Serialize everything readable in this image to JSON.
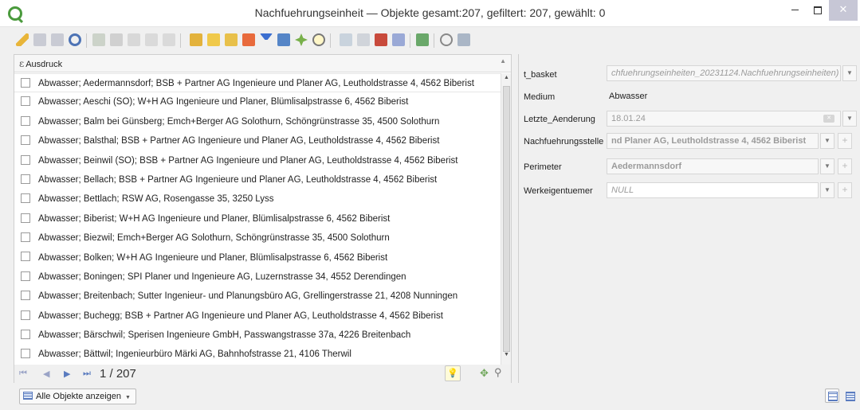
{
  "window": {
    "title": "Nachfuehrungseinheit — Objekte gesamt:207, gefiltert: 207, gewählt: 0"
  },
  "toolbar": {
    "icons": [
      "pencil-icon",
      "save-icon",
      "save-all-icon",
      "reload-icon",
      "add-feature-icon",
      "delete-icon",
      "cut-icon",
      "copy-icon",
      "paste-icon",
      "expression-select-icon",
      "select-all-icon",
      "invert-selection-icon",
      "deselect-icon",
      "filter-icon",
      "move-selection-top-icon",
      "pan-icon",
      "zoom-icon",
      "new-field-icon",
      "delete-field-icon",
      "field-calculator-icon",
      "conditional-format-icon",
      "actions-icon",
      "dock-icon",
      "dock-toggle-icon"
    ]
  },
  "list": {
    "header": "Ausdruck",
    "rows": [
      "Abwasser; Aedermannsdorf; BSB + Partner AG Ingenieure und Planer AG, Leutholdstrasse 4, 4562 Biberist",
      "Abwasser; Aeschi (SO); W+H AG Ingenieure und Planer, Blümlisalpstrasse 6, 4562 Biberist",
      "Abwasser; Balm bei Günsberg; Emch+Berger AG Solothurn, Schöngrünstrasse 35, 4500 Solothurn",
      "Abwasser; Balsthal; BSB + Partner AG Ingenieure und Planer AG, Leutholdstrasse 4, 4562 Biberist",
      "Abwasser; Beinwil (SO); BSB + Partner AG Ingenieure und Planer AG, Leutholdstrasse 4, 4562 Biberist",
      "Abwasser; Bellach; BSB + Partner AG Ingenieure und Planer AG, Leutholdstrasse 4, 4562 Biberist",
      "Abwasser; Bettlach; RSW AG, Rosengasse 35, 3250 Lyss",
      "Abwasser; Biberist; W+H AG Ingenieure und Planer, Blümlisalpstrasse 6, 4562 Biberist",
      "Abwasser; Biezwil; Emch+Berger AG Solothurn, Schöngrünstrasse 35, 4500 Solothurn",
      "Abwasser; Bolken; W+H AG Ingenieure und Planer, Blümlisalpstrasse 6, 4562 Biberist",
      "Abwasser; Boningen; SPI Planer und Ingenieure AG, Luzernstrasse 34, 4552 Derendingen",
      "Abwasser; Breitenbach; Sutter Ingenieur- und Planungsbüro AG, Grellingerstrasse 21, 4208 Nunningen",
      "Abwasser; Buchegg; BSB + Partner AG Ingenieure und Planer AG, Leutholdstrasse 4, 4562 Biberist",
      "Abwasser; Bärschwil; Sperisen Ingenieure GmbH, Passwangstrasse 37a, 4226 Breitenbach",
      "Abwasser; Bättwil; Ingenieurbüro Märki AG, Bahnhofstrasse 21, 4106 Therwil"
    ]
  },
  "nav": {
    "counter": "1 / 207"
  },
  "form": {
    "fields": [
      {
        "label": "t_basket",
        "value": "chfuehrungseinheiten_20231124.Nachfuehrungseinheiten)"
      },
      {
        "label": "Medium",
        "value": "Abwasser"
      },
      {
        "label": "Letzte_Aenderung",
        "value": "18.01.24"
      },
      {
        "label": "Nachfuehrungsstelle",
        "value": "nd Planer AG, Leutholdstrasse 4, 4562 Biberist"
      },
      {
        "label": "Perimeter",
        "value": "Aedermannsdorf"
      },
      {
        "label": "Werkeigentuemer",
        "value": "NULL"
      }
    ]
  },
  "bottom": {
    "show_all_label": "Alle Objekte anzeigen"
  },
  "colors": {
    "accent": "#5a7bbf",
    "qgis_green": "#4a9a3c"
  }
}
